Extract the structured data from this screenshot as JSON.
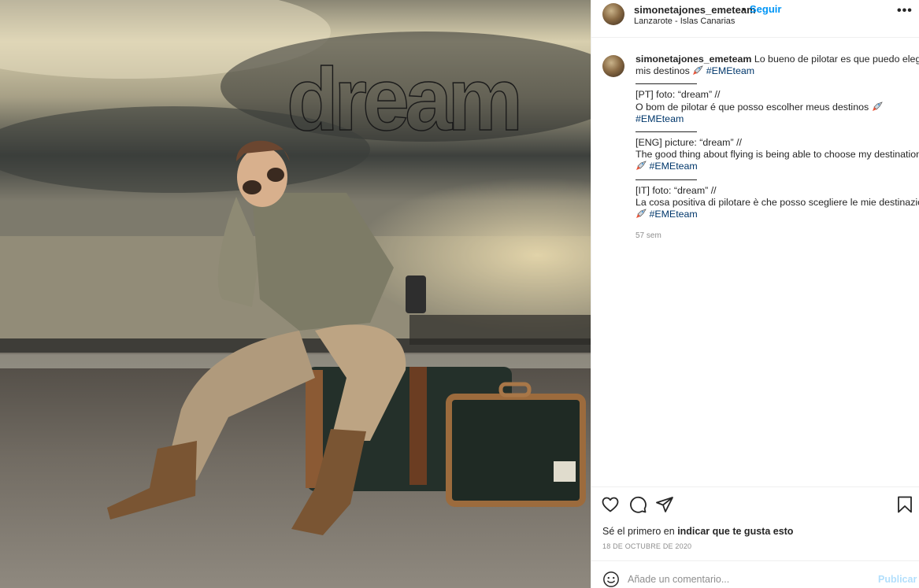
{
  "photo": {
    "overlay_text": "dream"
  },
  "header": {
    "username": "simonetajones_emeteam",
    "separator": "•",
    "follow_label": "Seguir",
    "location": "Lanzarote - Islas Canarias",
    "more_label": "•••"
  },
  "caption": {
    "username": "simonetajones_emeteam",
    "line1": "Lo bueno de pilotar es que puedo elegir",
    "line2": "mis destinos",
    "hashtag": "#EMEteam",
    "pt_title": "[PT] foto: “dream” //",
    "pt_text": "O bom de pilotar é que posso escolher meus destinos",
    "eng_title": "[ENG] picture: “dream” //",
    "eng_text": "The good thing about flying is being able to choose my destination",
    "it_title": "[IT] foto: “dream” //",
    "it_text": "La cosa positiva di pilotare è che posso scegliere le mie destinazioni",
    "time": "57 sem"
  },
  "actions": {
    "likes_prefix": "Sé el primero en ",
    "likes_link": "indicar que te gusta esto",
    "date": "18 DE OCTUBRE DE 2020"
  },
  "comment": {
    "placeholder": "Añade un comentario...",
    "publish_label": "Publicar"
  },
  "icons": [
    "heart-icon",
    "comment-icon",
    "share-icon",
    "bookmark-icon",
    "emoji-icon",
    "rocket-icon",
    "more-icon"
  ],
  "colors": {
    "link": "#0095f6",
    "hashtag": "#00376b",
    "muted": "#8e8e8e",
    "publish_disabled": "#b2dffc"
  }
}
